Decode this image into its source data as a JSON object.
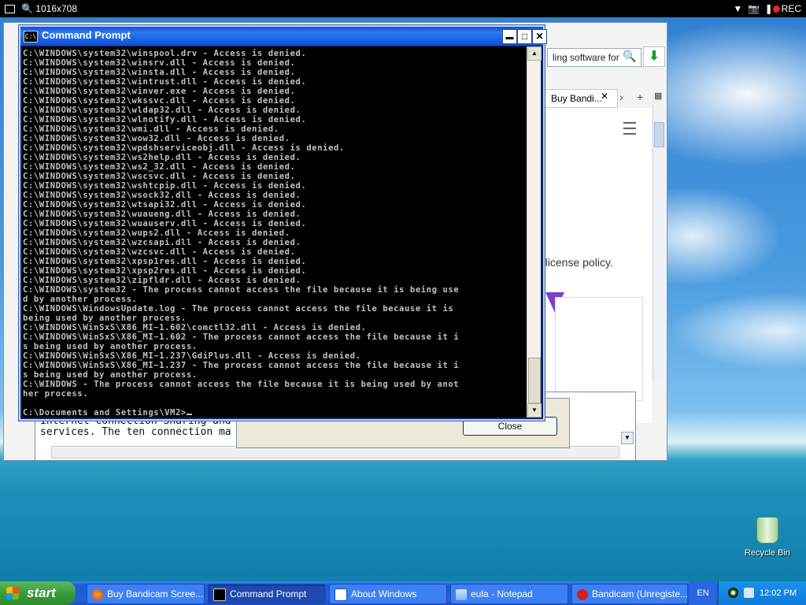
{
  "recorder": {
    "resolution": "1016x708",
    "rec_label": "REC"
  },
  "browser": {
    "address_text": "ling software for",
    "tab_label": "Buy Bandi...",
    "policy_text": "e license policy."
  },
  "notepad": {
    "text": "Internet Connection Sharing and\nservices. The ten connection ma"
  },
  "about_dialog": {
    "close_label": "Close"
  },
  "cmd": {
    "title": "Command Prompt",
    "lines": [
      "C:\\WINDOWS\\system32\\winspool.drv - Access is denied.",
      "C:\\WINDOWS\\system32\\winsrv.dll - Access is denied.",
      "C:\\WINDOWS\\system32\\winsta.dll - Access is denied.",
      "C:\\WINDOWS\\system32\\wintrust.dll - Access is denied.",
      "C:\\WINDOWS\\system32\\winver.exe - Access is denied.",
      "C:\\WINDOWS\\system32\\wkssvc.dll - Access is denied.",
      "C:\\WINDOWS\\system32\\wldap32.dll - Access is denied.",
      "C:\\WINDOWS\\system32\\wlnotify.dll - Access is denied.",
      "C:\\WINDOWS\\system32\\wmi.dll - Access is denied.",
      "C:\\WINDOWS\\system32\\wow32.dll - Access is denied.",
      "C:\\WINDOWS\\system32\\wpdshserviceobj.dll - Access is denied.",
      "C:\\WINDOWS\\system32\\ws2help.dll - Access is denied.",
      "C:\\WINDOWS\\system32\\ws2_32.dll - Access is denied.",
      "C:\\WINDOWS\\system32\\wscsvc.dll - Access is denied.",
      "C:\\WINDOWS\\system32\\wshtcpip.dll - Access is denied.",
      "C:\\WINDOWS\\system32\\wsock32.dll - Access is denied.",
      "C:\\WINDOWS\\system32\\wtsapi32.dll - Access is denied.",
      "C:\\WINDOWS\\system32\\wuaueng.dll - Access is denied.",
      "C:\\WINDOWS\\system32\\wuauserv.dll - Access is denied.",
      "C:\\WINDOWS\\system32\\wups2.dll - Access is denied.",
      "C:\\WINDOWS\\system32\\wzcsapi.dll - Access is denied.",
      "C:\\WINDOWS\\system32\\wzcsvc.dll - Access is denied.",
      "C:\\WINDOWS\\system32\\xpsp1res.dll - Access is denied.",
      "C:\\WINDOWS\\system32\\xpsp2res.dll - Access is denied.",
      "C:\\WINDOWS\\system32\\zipfldr.dll - Access is denied.",
      "C:\\WINDOWS\\system32 - The process cannot access the file because it is being use",
      "d by another process.",
      "C:\\WINDOWS\\WindowsUpdate.log - The process cannot access the file because it is",
      "being used by another process.",
      "C:\\WINDOWS\\WinSxS\\X86_MI~1.602\\comctl32.dll - Access is denied.",
      "C:\\WINDOWS\\WinSxS\\X86_MI~1.602 - The process cannot access the file because it i",
      "s being used by another process.",
      "C:\\WINDOWS\\WinSxS\\X86_MI~1.237\\GdiPlus.dll - Access is denied.",
      "C:\\WINDOWS\\WinSxS\\X86_MI~1.237 - The process cannot access the file because it i",
      "s being used by another process.",
      "C:\\WINDOWS - The process cannot access the file because it is being used by anot",
      "her process.",
      "",
      "C:\\Documents and Settings\\VM2>"
    ]
  },
  "desktop": {
    "recycle_bin_label": "Recycle Bin"
  },
  "taskbar": {
    "start_label": "start",
    "tasks": [
      {
        "label": "Buy Bandicam Scree...",
        "icon": "firefox-icon"
      },
      {
        "label": "Command Prompt",
        "icon": "cmd-icon"
      },
      {
        "label": "About Windows",
        "icon": "window-icon"
      },
      {
        "label": "eula - Notepad",
        "icon": "notepad-icon"
      },
      {
        "label": "Bandicam (Unregiste...",
        "icon": "bandicam-icon"
      }
    ],
    "language": "EN",
    "clock": "12:02 PM"
  }
}
